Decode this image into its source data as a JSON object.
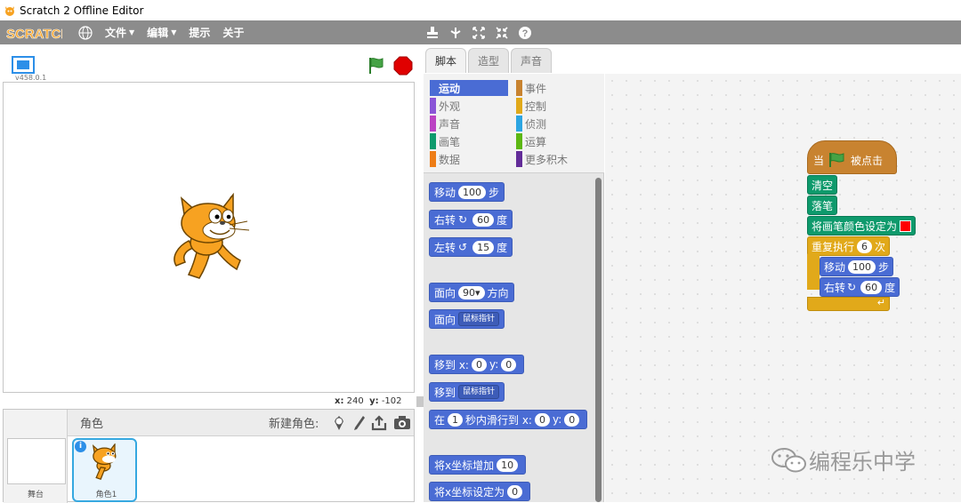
{
  "window": {
    "title": "Scratch 2 Offline Editor"
  },
  "menubar": {
    "logo": "SCRATCH",
    "menus": [
      "文件",
      "编辑",
      "提示",
      "关于"
    ]
  },
  "stage": {
    "version": "v458.0.1",
    "coord_x_label": "x:",
    "coord_x": "240",
    "coord_y_label": "y:",
    "coord_y": "-102"
  },
  "sprites": {
    "header": "角色",
    "new_sprite": "新建角色:",
    "stage_label": "舞台",
    "sprite_name": "角色1"
  },
  "tabs": [
    "脚本",
    "造型",
    "声音"
  ],
  "categories": [
    {
      "label": "运动",
      "color": "#4a6cd4"
    },
    {
      "label": "事件",
      "color": "#c88330"
    },
    {
      "label": "外观",
      "color": "#8a55d7"
    },
    {
      "label": "控制",
      "color": "#e1a91a"
    },
    {
      "label": "声音",
      "color": "#bb42c3"
    },
    {
      "label": "侦测",
      "color": "#2ca5e2"
    },
    {
      "label": "画笔",
      "color": "#0e9a6c"
    },
    {
      "label": "运算",
      "color": "#5cb712"
    },
    {
      "label": "数据",
      "color": "#ee7d16"
    },
    {
      "label": "更多积木",
      "color": "#632d99"
    }
  ],
  "palette": {
    "move": {
      "pre": "移动",
      "val": "100",
      "post": "步"
    },
    "turn_right": {
      "pre": "右转",
      "val": "60",
      "post": "度"
    },
    "turn_left": {
      "pre": "左转",
      "val": "15",
      "post": "度"
    },
    "point_dir": {
      "pre": "面向",
      "val": "90▾",
      "post": "方向"
    },
    "point_towards": {
      "pre": "面向",
      "dd": "鼠标指针"
    },
    "goto_xy": {
      "pre": "移到 x:",
      "x": "0",
      "mid": "y:",
      "y": "0"
    },
    "goto": {
      "pre": "移到",
      "dd": "鼠标指针"
    },
    "glide": {
      "pre": "在",
      "secs": "1",
      "mid": "秒内滑行到 x:",
      "x": "0",
      "mid2": "y:",
      "y": "0"
    },
    "change_x": {
      "pre": "将x坐标增加",
      "val": "10"
    },
    "set_x": {
      "pre": "将x坐标设定为",
      "val": "0"
    }
  },
  "script": {
    "hat_pre": "当",
    "hat_post": "被点击",
    "clear": "清空",
    "pen_down": "落笔",
    "set_color": "将画笔颜色设定为",
    "repeat_pre": "重复执行",
    "repeat_val": "6",
    "repeat_post": "次",
    "move_pre": "移动",
    "move_val": "100",
    "move_post": "步",
    "turn_pre": "右转",
    "turn_val": "60",
    "turn_post": "度"
  },
  "watermark": "编程乐中学"
}
